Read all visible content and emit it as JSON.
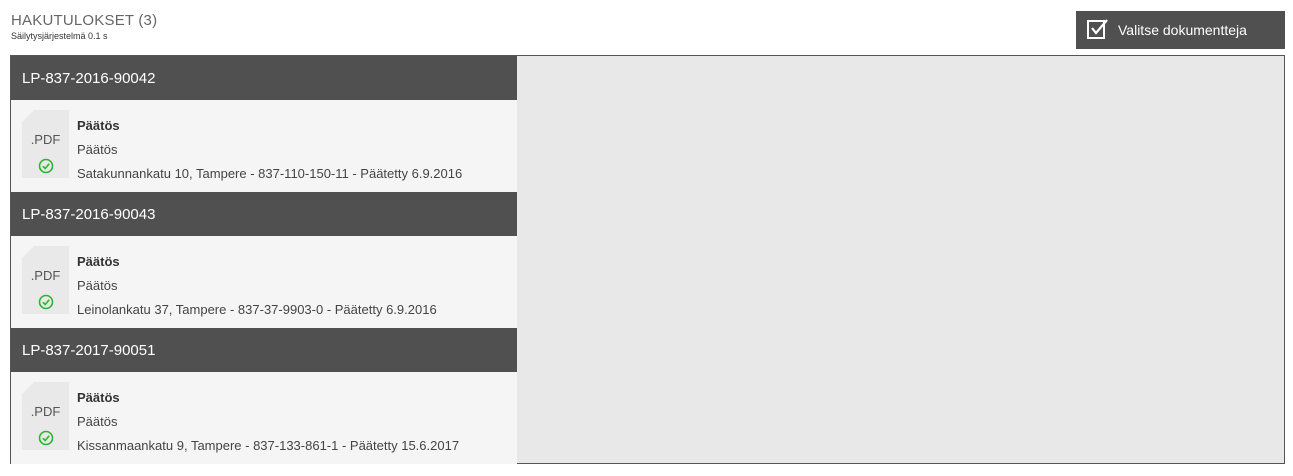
{
  "header": {
    "title": "HAKUTULOKSET (3)",
    "subtitle": "Säilytysjärjestelmä 0.1 s"
  },
  "toolbar": {
    "select_documents_label": "Valitse dokumentteja"
  },
  "results": [
    {
      "id": "LP-837-2016-90042",
      "doc_type": ".PDF",
      "doc_name": "Päätös",
      "doc_subtype": "Päätös",
      "details": "Satakunnankatu 10, Tampere - 837-110-150-11 - Päätetty 6.9.2016"
    },
    {
      "id": "LP-837-2016-90043",
      "doc_type": ".PDF",
      "doc_name": "Päätös",
      "doc_subtype": "Päätös",
      "details": "Leinolankatu 37, Tampere - 837-37-9903-0 - Päätetty 6.9.2016"
    },
    {
      "id": "LP-837-2017-90051",
      "doc_type": ".PDF",
      "doc_name": "Päätös",
      "doc_subtype": "Päätös",
      "details": "Kissanmaankatu 9, Tampere - 837-133-861-1 - Päätetty 15.6.2017"
    }
  ],
  "colors": {
    "header_bg": "#505050",
    "panel_bg": "#e8e8e8",
    "check_green": "#2db52d"
  },
  "icons": {
    "select_button": "checkbox-check-icon",
    "document": "document-icon",
    "status": "check-circle-icon"
  }
}
